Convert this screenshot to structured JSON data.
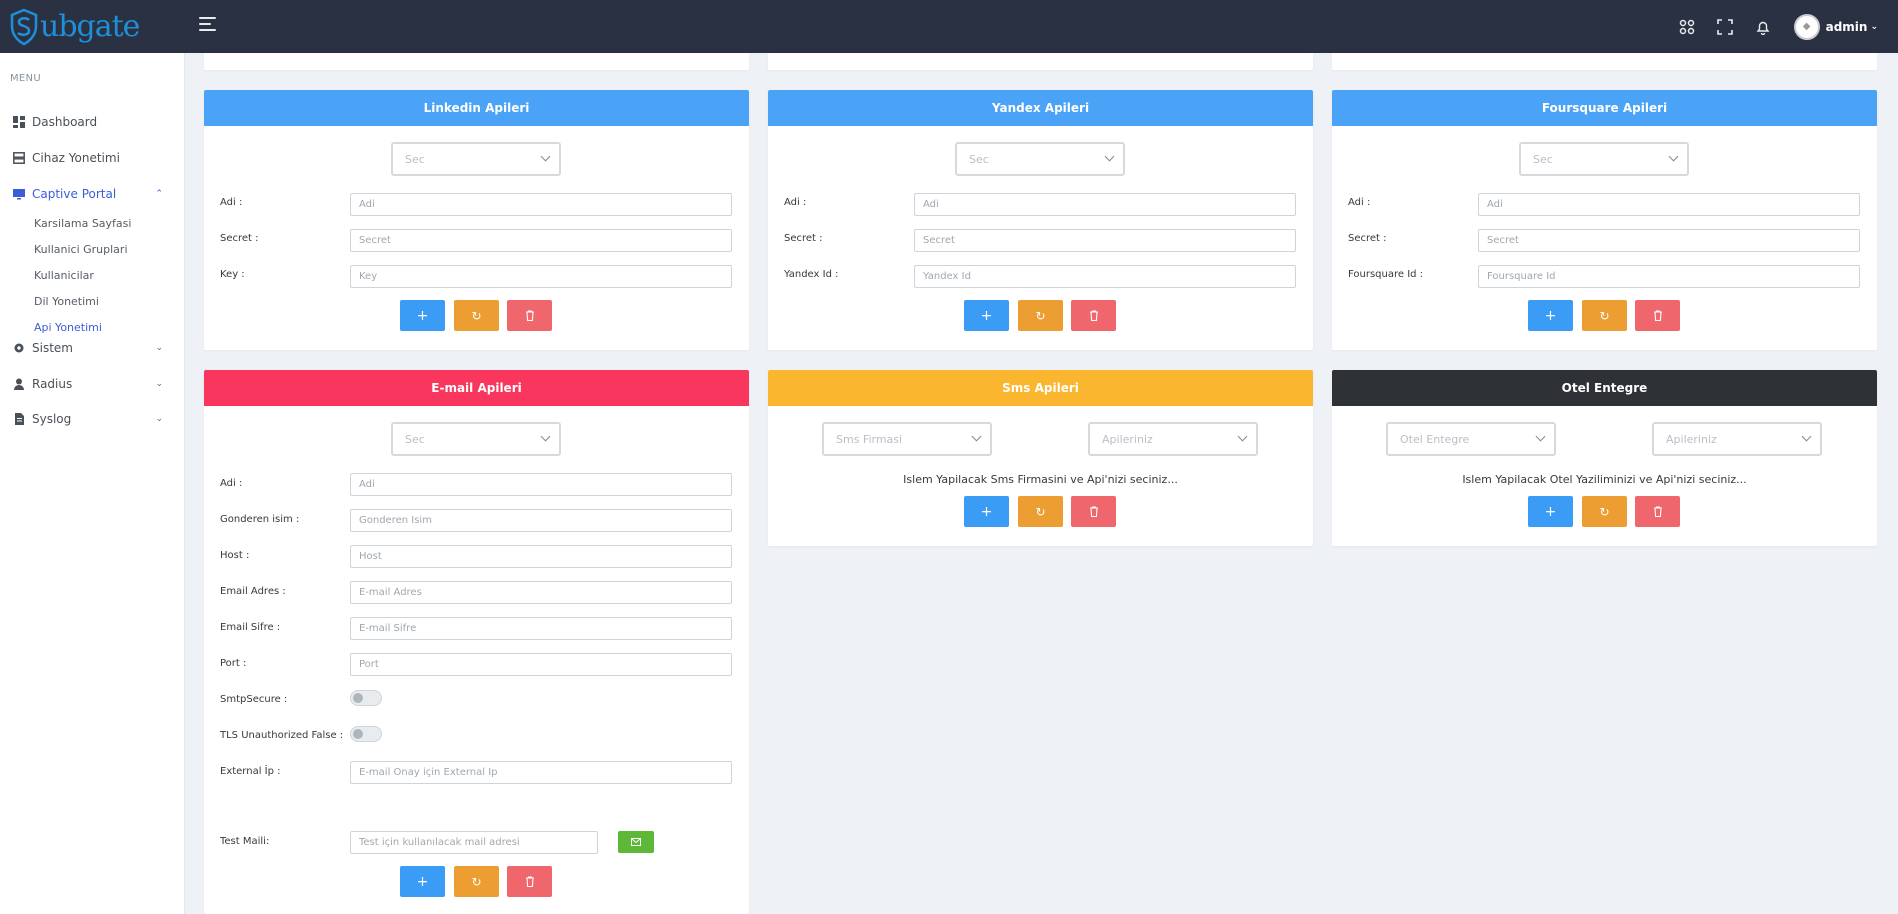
{
  "brand": {
    "logo_text": "ubgate"
  },
  "topbar": {
    "user_name": "admin"
  },
  "sidebar": {
    "menu_title": "MENU",
    "items": [
      {
        "label": "Dashboard"
      },
      {
        "label": "Cihaz Yonetimi"
      },
      {
        "label": "Captive Portal"
      },
      {
        "label": "Sistem"
      },
      {
        "label": "Radius"
      },
      {
        "label": "Syslog"
      }
    ],
    "captive_sub": [
      {
        "label": "Karsilama Sayfasi"
      },
      {
        "label": "Kullanici Gruplari"
      },
      {
        "label": "Kullanicilar"
      },
      {
        "label": "Dil Yonetimi"
      },
      {
        "label": "Api Yonetimi"
      }
    ]
  },
  "linkedin": {
    "title": "Linkedin Apileri",
    "select": "Sec",
    "fields": [
      {
        "label": "Adi :",
        "placeholder": "Adi"
      },
      {
        "label": "Secret :",
        "placeholder": "Secret"
      },
      {
        "label": "Key :",
        "placeholder": "Key"
      }
    ]
  },
  "yandex": {
    "title": "Yandex Apileri",
    "select": "Sec",
    "fields": [
      {
        "label": "Adi :",
        "placeholder": "Adi"
      },
      {
        "label": "Secret :",
        "placeholder": "Secret"
      },
      {
        "label": "Yandex Id :",
        "placeholder": "Yandex Id"
      }
    ]
  },
  "foursquare": {
    "title": "Foursquare Apileri",
    "select": "Sec",
    "fields": [
      {
        "label": "Adi :",
        "placeholder": "Adi"
      },
      {
        "label": "Secret :",
        "placeholder": "Secret"
      },
      {
        "label": "Foursquare Id :",
        "placeholder": "Foursquare Id"
      }
    ]
  },
  "email": {
    "title": "E-mail Apileri",
    "select": "Sec",
    "fields": [
      {
        "label": "Adi :",
        "placeholder": "Adi"
      },
      {
        "label": "Gonderen isim :",
        "placeholder": "Gonderen Isim"
      },
      {
        "label": "Host :",
        "placeholder": "Host"
      },
      {
        "label": "Email Adres :",
        "placeholder": "E-mail Adres"
      },
      {
        "label": "Email Sifre :",
        "placeholder": "E-mail Sifre"
      },
      {
        "label": "Port :",
        "placeholder": "Port"
      }
    ],
    "smtp_label": "SmtpSecure :",
    "tls_label": "TLS Unauthorized False :",
    "external_label": "External İp :",
    "external_placeholder": "E-mail Onay için External İp",
    "test_label": "Test Maili:",
    "test_placeholder": "Test için kullanılacak mail adresi"
  },
  "sms": {
    "title": "Sms Apileri",
    "select1": "Sms Firmasi",
    "select2": "Apileriniz",
    "info": "Islem Yapilacak Sms Firmasini ve Api'nizi seciniz..."
  },
  "otel": {
    "title": "Otel Entegre",
    "select1": "Otel Entegre",
    "select2": "Apileriniz",
    "info": "Islem Yapilacak Otel Yaziliminizi ve Api'nizi seciniz..."
  },
  "colors": {
    "topbar": "#2a3142",
    "card_blue": "#4aa3f7",
    "card_red": "#f9365e",
    "card_yellow": "#fbb62f",
    "card_dark": "#2e3136",
    "btn_add": "#3a9cf5",
    "btn_refresh": "#ec9e32",
    "btn_delete": "#f0666d"
  }
}
